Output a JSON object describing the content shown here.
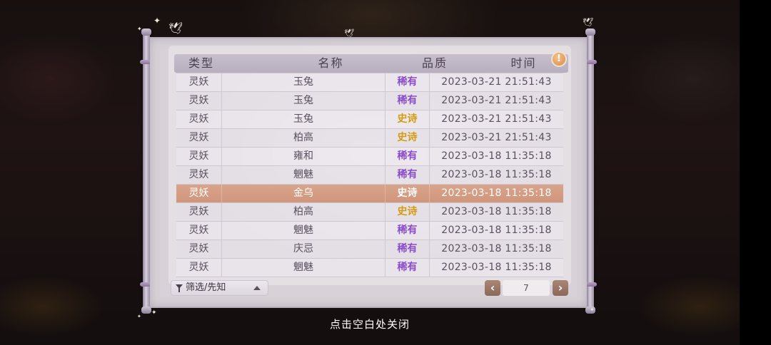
{
  "table": {
    "headers": [
      "类型",
      "名称",
      "品质",
      "时间"
    ],
    "rows": [
      {
        "type": "灵妖",
        "name": "玉兔",
        "quality": "稀有",
        "time": "2023-03-21  21:51:43"
      },
      {
        "type": "灵妖",
        "name": "玉兔",
        "quality": "稀有",
        "time": "2023-03-21  21:51:43"
      },
      {
        "type": "灵妖",
        "name": "玉兔",
        "quality": "史诗",
        "time": "2023-03-21  21:51:43"
      },
      {
        "type": "灵妖",
        "name": "柏高",
        "quality": "史诗",
        "time": "2023-03-21  21:51:43"
      },
      {
        "type": "灵妖",
        "name": "雍和",
        "quality": "稀有",
        "time": "2023-03-18  11:35:18"
      },
      {
        "type": "灵妖",
        "name": "魍魅",
        "quality": "稀有",
        "time": "2023-03-18  11:35:18"
      },
      {
        "type": "灵妖",
        "name": "金乌",
        "quality": "史诗",
        "time": "2023-03-18  11:35:18"
      },
      {
        "type": "灵妖",
        "name": "柏高",
        "quality": "史诗",
        "time": "2023-03-18  11:35:18"
      },
      {
        "type": "灵妖",
        "name": "魍魅",
        "quality": "稀有",
        "time": "2023-03-18  11:35:18"
      },
      {
        "type": "灵妖",
        "name": "庆忌",
        "quality": "稀有",
        "time": "2023-03-18  11:35:18"
      },
      {
        "type": "灵妖",
        "name": "魍魅",
        "quality": "稀有",
        "time": "2023-03-18  11:35:18"
      }
    ],
    "selected_index": 6
  },
  "info_button": {
    "label": "!",
    "icon": "exclamation-icon"
  },
  "filter": {
    "label": "筛选/先知",
    "icon": "funnel-icon",
    "caret_icon": "caret-up-icon"
  },
  "pagination": {
    "current_page": "7",
    "prev_icon": "chevron-left-icon",
    "next_icon": "chevron-right-icon",
    "prev_glyph": "‹",
    "next_glyph": "›"
  },
  "close_hint": "点击空白处关闭",
  "colors": {
    "rare": "#8a4cc9",
    "epic": "#d49a12",
    "selected_row": "#d8a48b"
  }
}
